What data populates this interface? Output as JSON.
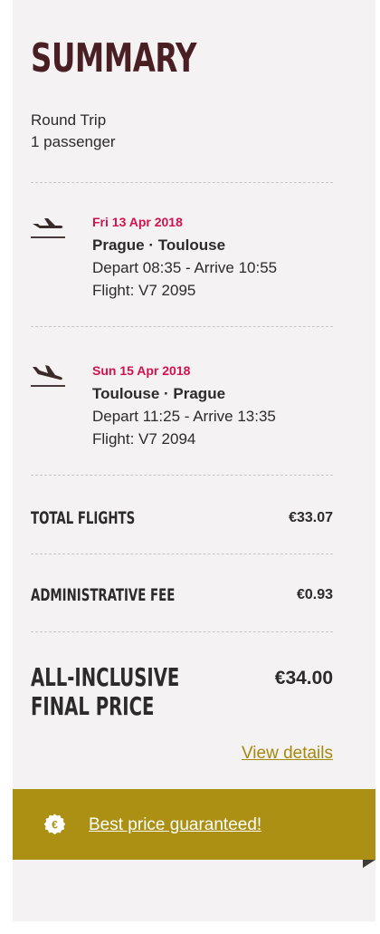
{
  "summary": {
    "title": "SUMMARY",
    "trip_type": "Round Trip",
    "passengers": "1 passenger"
  },
  "flights": [
    {
      "date": "Fri 13 Apr 2018",
      "route": "Prague · Toulouse",
      "times": "Depart 08:35 - Arrive 10:55",
      "flight_number": "Flight: V7 2095",
      "icon": "plane-takeoff-icon"
    },
    {
      "date": "Sun 15 Apr 2018",
      "route": "Toulouse · Prague",
      "times": "Depart 11:25 - Arrive 13:35",
      "flight_number": "Flight: V7 2094",
      "icon": "plane-landing-icon"
    }
  ],
  "totals": {
    "flights_label": "TOTAL FLIGHTS",
    "flights_value": "€33.07",
    "fee_label": "ADMINISTRATIVE FEE",
    "fee_value": "€0.93",
    "final_label_line1": "ALL-INCLUSIVE",
    "final_label_line2": "FINAL PRICE",
    "final_value": "€34.00",
    "view_details": "View details"
  },
  "banner": {
    "text": "Best price guaranteed!",
    "icon": "euro-badge-icon",
    "badge_symbol": "€"
  },
  "colors": {
    "title": "#4a1f24",
    "date_accent": "#d4114f",
    "link": "#a38a0f",
    "banner": "#ac9013",
    "panel": "#f4f2f2"
  }
}
